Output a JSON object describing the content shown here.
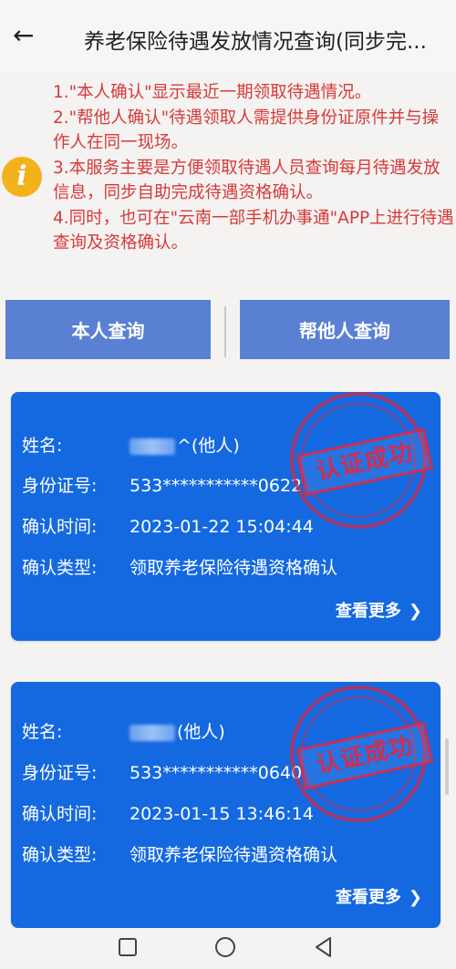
{
  "header": {
    "title": "养老保险待遇发放情况查询(同步完..."
  },
  "notice": {
    "lines": [
      "1.\"本人确认\"显示最近一期领取待遇情况。",
      "2.\"帮他人确认\"待遇领取人需提供身份证原件并与操作人在同一现场。",
      "3.本服务主要是方便领取待遇人员查询每月待遇发放信息，同步自助完成待遇资格确认。",
      "4.同时，也可在\"云南一部手机办事通\"APP上进行待遇查询及资格确认。"
    ]
  },
  "buttons": {
    "self_query": "本人查询",
    "other_query": "帮他人查询"
  },
  "labels": {
    "name": "姓名:",
    "id_number": "身份证号:",
    "confirm_time": "确认时间:",
    "confirm_type": "确认类型:",
    "view_more": "查看更多",
    "stamp": "认证成功"
  },
  "records": [
    {
      "name_suffix": "^(他人)",
      "id_number": "533***********0622",
      "confirm_time": "2023-01-22 15:04:44",
      "confirm_type": "领取养老保险待遇资格确认"
    },
    {
      "name_suffix": "(他人)",
      "id_number": "533***********0640",
      "confirm_time": "2023-01-15 13:46:14",
      "confirm_type": "领取养老保险待遇资格确认"
    }
  ],
  "colors": {
    "notice_text": "#d63a3a",
    "card_bg": "#1469e0",
    "button_bg": "#5a80d3",
    "stamp": "#dc2846",
    "info_icon": "#f3b21b"
  },
  "icons": {
    "back": "back-arrow-icon",
    "info": "info-icon",
    "chevron": "chevron-right-icon",
    "nav_square": "recent-apps-icon",
    "nav_circle": "home-icon",
    "nav_triangle": "back-triangle-icon"
  }
}
